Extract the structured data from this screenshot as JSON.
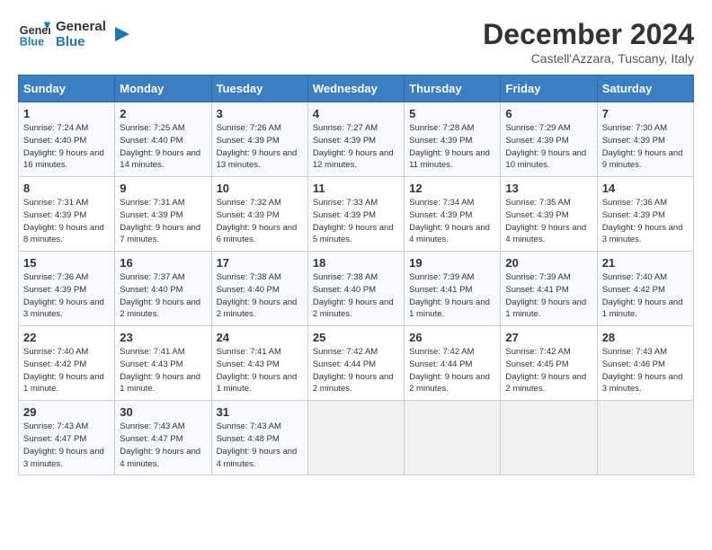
{
  "header": {
    "logo_line1": "General",
    "logo_line2": "Blue",
    "month": "December 2024",
    "location": "Castell'Azzara, Tuscany, Italy"
  },
  "weekdays": [
    "Sunday",
    "Monday",
    "Tuesday",
    "Wednesday",
    "Thursday",
    "Friday",
    "Saturday"
  ],
  "weeks": [
    [
      {
        "day": "1",
        "sunrise": "Sunrise: 7:24 AM",
        "sunset": "Sunset: 4:40 PM",
        "daylight": "Daylight: 9 hours and 16 minutes."
      },
      {
        "day": "2",
        "sunrise": "Sunrise: 7:25 AM",
        "sunset": "Sunset: 4:40 PM",
        "daylight": "Daylight: 9 hours and 14 minutes."
      },
      {
        "day": "3",
        "sunrise": "Sunrise: 7:26 AM",
        "sunset": "Sunset: 4:39 PM",
        "daylight": "Daylight: 9 hours and 13 minutes."
      },
      {
        "day": "4",
        "sunrise": "Sunrise: 7:27 AM",
        "sunset": "Sunset: 4:39 PM",
        "daylight": "Daylight: 9 hours and 12 minutes."
      },
      {
        "day": "5",
        "sunrise": "Sunrise: 7:28 AM",
        "sunset": "Sunset: 4:39 PM",
        "daylight": "Daylight: 9 hours and 11 minutes."
      },
      {
        "day": "6",
        "sunrise": "Sunrise: 7:29 AM",
        "sunset": "Sunset: 4:39 PM",
        "daylight": "Daylight: 9 hours and 10 minutes."
      },
      {
        "day": "7",
        "sunrise": "Sunrise: 7:30 AM",
        "sunset": "Sunset: 4:39 PM",
        "daylight": "Daylight: 9 hours and 9 minutes."
      }
    ],
    [
      {
        "day": "8",
        "sunrise": "Sunrise: 7:31 AM",
        "sunset": "Sunset: 4:39 PM",
        "daylight": "Daylight: 9 hours and 8 minutes."
      },
      {
        "day": "9",
        "sunrise": "Sunrise: 7:31 AM",
        "sunset": "Sunset: 4:39 PM",
        "daylight": "Daylight: 9 hours and 7 minutes."
      },
      {
        "day": "10",
        "sunrise": "Sunrise: 7:32 AM",
        "sunset": "Sunset: 4:39 PM",
        "daylight": "Daylight: 9 hours and 6 minutes."
      },
      {
        "day": "11",
        "sunrise": "Sunrise: 7:33 AM",
        "sunset": "Sunset: 4:39 PM",
        "daylight": "Daylight: 9 hours and 5 minutes."
      },
      {
        "day": "12",
        "sunrise": "Sunrise: 7:34 AM",
        "sunset": "Sunset: 4:39 PM",
        "daylight": "Daylight: 9 hours and 4 minutes."
      },
      {
        "day": "13",
        "sunrise": "Sunrise: 7:35 AM",
        "sunset": "Sunset: 4:39 PM",
        "daylight": "Daylight: 9 hours and 4 minutes."
      },
      {
        "day": "14",
        "sunrise": "Sunrise: 7:36 AM",
        "sunset": "Sunset: 4:39 PM",
        "daylight": "Daylight: 9 hours and 3 minutes."
      }
    ],
    [
      {
        "day": "15",
        "sunrise": "Sunrise: 7:36 AM",
        "sunset": "Sunset: 4:39 PM",
        "daylight": "Daylight: 9 hours and 3 minutes."
      },
      {
        "day": "16",
        "sunrise": "Sunrise: 7:37 AM",
        "sunset": "Sunset: 4:40 PM",
        "daylight": "Daylight: 9 hours and 2 minutes."
      },
      {
        "day": "17",
        "sunrise": "Sunrise: 7:38 AM",
        "sunset": "Sunset: 4:40 PM",
        "daylight": "Daylight: 9 hours and 2 minutes."
      },
      {
        "day": "18",
        "sunrise": "Sunrise: 7:38 AM",
        "sunset": "Sunset: 4:40 PM",
        "daylight": "Daylight: 9 hours and 2 minutes."
      },
      {
        "day": "19",
        "sunrise": "Sunrise: 7:39 AM",
        "sunset": "Sunset: 4:41 PM",
        "daylight": "Daylight: 9 hours and 1 minute."
      },
      {
        "day": "20",
        "sunrise": "Sunrise: 7:39 AM",
        "sunset": "Sunset: 4:41 PM",
        "daylight": "Daylight: 9 hours and 1 minute."
      },
      {
        "day": "21",
        "sunrise": "Sunrise: 7:40 AM",
        "sunset": "Sunset: 4:42 PM",
        "daylight": "Daylight: 9 hours and 1 minute."
      }
    ],
    [
      {
        "day": "22",
        "sunrise": "Sunrise: 7:40 AM",
        "sunset": "Sunset: 4:42 PM",
        "daylight": "Daylight: 9 hours and 1 minute."
      },
      {
        "day": "23",
        "sunrise": "Sunrise: 7:41 AM",
        "sunset": "Sunset: 4:43 PM",
        "daylight": "Daylight: 9 hours and 1 minute."
      },
      {
        "day": "24",
        "sunrise": "Sunrise: 7:41 AM",
        "sunset": "Sunset: 4:43 PM",
        "daylight": "Daylight: 9 hours and 1 minute."
      },
      {
        "day": "25",
        "sunrise": "Sunrise: 7:42 AM",
        "sunset": "Sunset: 4:44 PM",
        "daylight": "Daylight: 9 hours and 2 minutes."
      },
      {
        "day": "26",
        "sunrise": "Sunrise: 7:42 AM",
        "sunset": "Sunset: 4:44 PM",
        "daylight": "Daylight: 9 hours and 2 minutes."
      },
      {
        "day": "27",
        "sunrise": "Sunrise: 7:42 AM",
        "sunset": "Sunset: 4:45 PM",
        "daylight": "Daylight: 9 hours and 2 minutes."
      },
      {
        "day": "28",
        "sunrise": "Sunrise: 7:43 AM",
        "sunset": "Sunset: 4:46 PM",
        "daylight": "Daylight: 9 hours and 3 minutes."
      }
    ],
    [
      {
        "day": "29",
        "sunrise": "Sunrise: 7:43 AM",
        "sunset": "Sunset: 4:47 PM",
        "daylight": "Daylight: 9 hours and 3 minutes."
      },
      {
        "day": "30",
        "sunrise": "Sunrise: 7:43 AM",
        "sunset": "Sunset: 4:47 PM",
        "daylight": "Daylight: 9 hours and 4 minutes."
      },
      {
        "day": "31",
        "sunrise": "Sunrise: 7:43 AM",
        "sunset": "Sunset: 4:48 PM",
        "daylight": "Daylight: 9 hours and 4 minutes."
      },
      null,
      null,
      null,
      null
    ]
  ]
}
